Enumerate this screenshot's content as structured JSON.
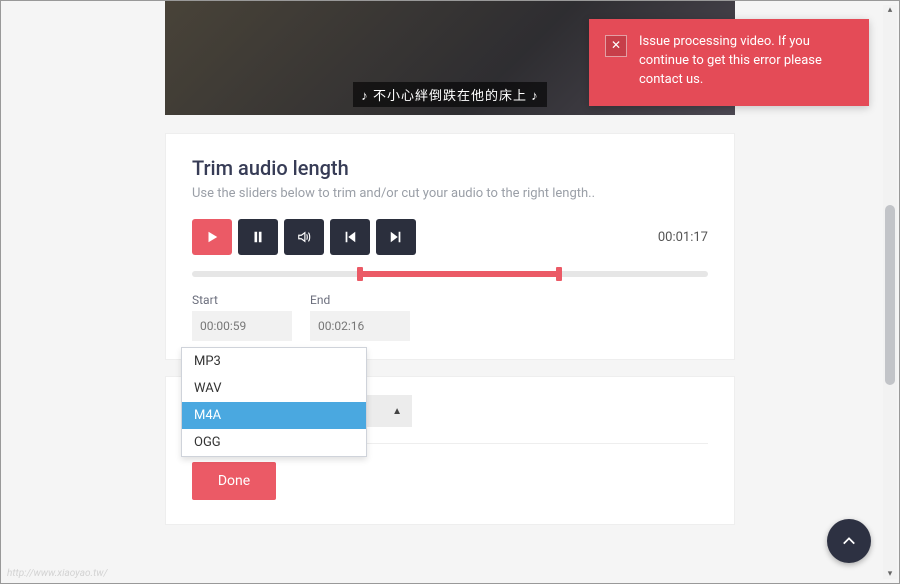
{
  "video": {
    "subtitle": "♪ 不小心絆倒跌在他的床上 ♪"
  },
  "toast": {
    "message": "Issue processing video. If you continue to get this error please contact us."
  },
  "trim": {
    "title": "Trim audio length",
    "subtitle": "Use the sliders below to trim and/or cut your audio to the right length..",
    "duration": "00:01:17",
    "start_label": "Start",
    "end_label": "End",
    "start_value": "00:00:59",
    "end_value": "00:02:16"
  },
  "format": {
    "options": [
      "MP3",
      "WAV",
      "M4A",
      "OGG"
    ],
    "selected": "M4A"
  },
  "done_label": "Done",
  "watermark": "http://www.xiaoyao.tw/"
}
